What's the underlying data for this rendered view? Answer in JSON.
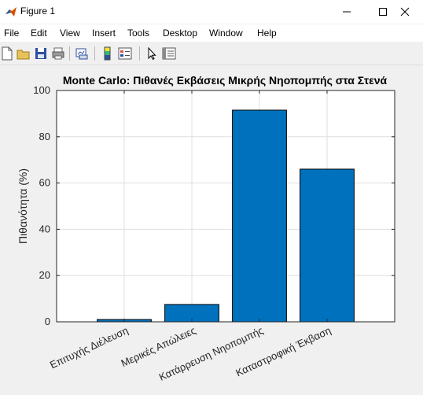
{
  "window": {
    "title": "Figure 1"
  },
  "menu": [
    "File",
    "Edit",
    "View",
    "Insert",
    "Tools",
    "Desktop",
    "Window",
    "Help"
  ],
  "toolbar_icons": [
    "new-figure-icon",
    "open-file-icon",
    "save-icon",
    "print-icon",
    "link-plot-icon",
    "colorbar-icon",
    "legend-icon",
    "edit-plot-arrow-icon",
    "property-inspector-icon"
  ],
  "colors": {
    "bar": "#0072BD",
    "figure_bg": "#f0f0f0",
    "axes_bg": "#ffffff",
    "grid": "#dfdfdf"
  },
  "chart_data": {
    "type": "bar",
    "title": "Monte Carlo: Πιθανές Εκβάσεις Μικρής Νηοπομπής στα Στενά",
    "xlabel": "",
    "ylabel": "Πιθανότητα (%)",
    "categories": [
      "Επιτυχής Διέλευση",
      "Μερικές Απώλειες",
      "Κατάρρευση Νηοπομπής",
      "Καταστροφική Έκβαση"
    ],
    "values": [
      1,
      7.5,
      91.5,
      66
    ],
    "ylim": [
      0,
      100
    ],
    "yticks": [
      0,
      20,
      40,
      60,
      80,
      100
    ],
    "grid": true,
    "legend": "none"
  }
}
